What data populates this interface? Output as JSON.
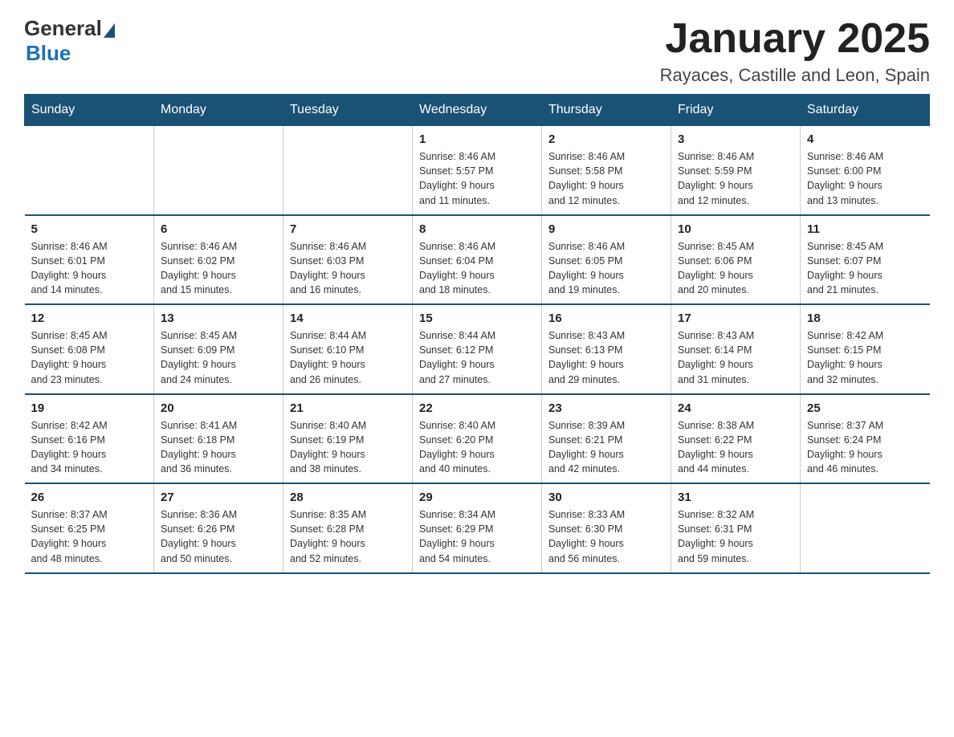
{
  "logo": {
    "general": "General",
    "blue": "Blue"
  },
  "title": "January 2025",
  "subtitle": "Rayaces, Castille and Leon, Spain",
  "days_of_week": [
    "Sunday",
    "Monday",
    "Tuesday",
    "Wednesday",
    "Thursday",
    "Friday",
    "Saturday"
  ],
  "weeks": [
    [
      {
        "day": "",
        "info": ""
      },
      {
        "day": "",
        "info": ""
      },
      {
        "day": "",
        "info": ""
      },
      {
        "day": "1",
        "info": "Sunrise: 8:46 AM\nSunset: 5:57 PM\nDaylight: 9 hours\nand 11 minutes."
      },
      {
        "day": "2",
        "info": "Sunrise: 8:46 AM\nSunset: 5:58 PM\nDaylight: 9 hours\nand 12 minutes."
      },
      {
        "day": "3",
        "info": "Sunrise: 8:46 AM\nSunset: 5:59 PM\nDaylight: 9 hours\nand 12 minutes."
      },
      {
        "day": "4",
        "info": "Sunrise: 8:46 AM\nSunset: 6:00 PM\nDaylight: 9 hours\nand 13 minutes."
      }
    ],
    [
      {
        "day": "5",
        "info": "Sunrise: 8:46 AM\nSunset: 6:01 PM\nDaylight: 9 hours\nand 14 minutes."
      },
      {
        "day": "6",
        "info": "Sunrise: 8:46 AM\nSunset: 6:02 PM\nDaylight: 9 hours\nand 15 minutes."
      },
      {
        "day": "7",
        "info": "Sunrise: 8:46 AM\nSunset: 6:03 PM\nDaylight: 9 hours\nand 16 minutes."
      },
      {
        "day": "8",
        "info": "Sunrise: 8:46 AM\nSunset: 6:04 PM\nDaylight: 9 hours\nand 18 minutes."
      },
      {
        "day": "9",
        "info": "Sunrise: 8:46 AM\nSunset: 6:05 PM\nDaylight: 9 hours\nand 19 minutes."
      },
      {
        "day": "10",
        "info": "Sunrise: 8:45 AM\nSunset: 6:06 PM\nDaylight: 9 hours\nand 20 minutes."
      },
      {
        "day": "11",
        "info": "Sunrise: 8:45 AM\nSunset: 6:07 PM\nDaylight: 9 hours\nand 21 minutes."
      }
    ],
    [
      {
        "day": "12",
        "info": "Sunrise: 8:45 AM\nSunset: 6:08 PM\nDaylight: 9 hours\nand 23 minutes."
      },
      {
        "day": "13",
        "info": "Sunrise: 8:45 AM\nSunset: 6:09 PM\nDaylight: 9 hours\nand 24 minutes."
      },
      {
        "day": "14",
        "info": "Sunrise: 8:44 AM\nSunset: 6:10 PM\nDaylight: 9 hours\nand 26 minutes."
      },
      {
        "day": "15",
        "info": "Sunrise: 8:44 AM\nSunset: 6:12 PM\nDaylight: 9 hours\nand 27 minutes."
      },
      {
        "day": "16",
        "info": "Sunrise: 8:43 AM\nSunset: 6:13 PM\nDaylight: 9 hours\nand 29 minutes."
      },
      {
        "day": "17",
        "info": "Sunrise: 8:43 AM\nSunset: 6:14 PM\nDaylight: 9 hours\nand 31 minutes."
      },
      {
        "day": "18",
        "info": "Sunrise: 8:42 AM\nSunset: 6:15 PM\nDaylight: 9 hours\nand 32 minutes."
      }
    ],
    [
      {
        "day": "19",
        "info": "Sunrise: 8:42 AM\nSunset: 6:16 PM\nDaylight: 9 hours\nand 34 minutes."
      },
      {
        "day": "20",
        "info": "Sunrise: 8:41 AM\nSunset: 6:18 PM\nDaylight: 9 hours\nand 36 minutes."
      },
      {
        "day": "21",
        "info": "Sunrise: 8:40 AM\nSunset: 6:19 PM\nDaylight: 9 hours\nand 38 minutes."
      },
      {
        "day": "22",
        "info": "Sunrise: 8:40 AM\nSunset: 6:20 PM\nDaylight: 9 hours\nand 40 minutes."
      },
      {
        "day": "23",
        "info": "Sunrise: 8:39 AM\nSunset: 6:21 PM\nDaylight: 9 hours\nand 42 minutes."
      },
      {
        "day": "24",
        "info": "Sunrise: 8:38 AM\nSunset: 6:22 PM\nDaylight: 9 hours\nand 44 minutes."
      },
      {
        "day": "25",
        "info": "Sunrise: 8:37 AM\nSunset: 6:24 PM\nDaylight: 9 hours\nand 46 minutes."
      }
    ],
    [
      {
        "day": "26",
        "info": "Sunrise: 8:37 AM\nSunset: 6:25 PM\nDaylight: 9 hours\nand 48 minutes."
      },
      {
        "day": "27",
        "info": "Sunrise: 8:36 AM\nSunset: 6:26 PM\nDaylight: 9 hours\nand 50 minutes."
      },
      {
        "day": "28",
        "info": "Sunrise: 8:35 AM\nSunset: 6:28 PM\nDaylight: 9 hours\nand 52 minutes."
      },
      {
        "day": "29",
        "info": "Sunrise: 8:34 AM\nSunset: 6:29 PM\nDaylight: 9 hours\nand 54 minutes."
      },
      {
        "day": "30",
        "info": "Sunrise: 8:33 AM\nSunset: 6:30 PM\nDaylight: 9 hours\nand 56 minutes."
      },
      {
        "day": "31",
        "info": "Sunrise: 8:32 AM\nSunset: 6:31 PM\nDaylight: 9 hours\nand 59 minutes."
      },
      {
        "day": "",
        "info": ""
      }
    ]
  ]
}
